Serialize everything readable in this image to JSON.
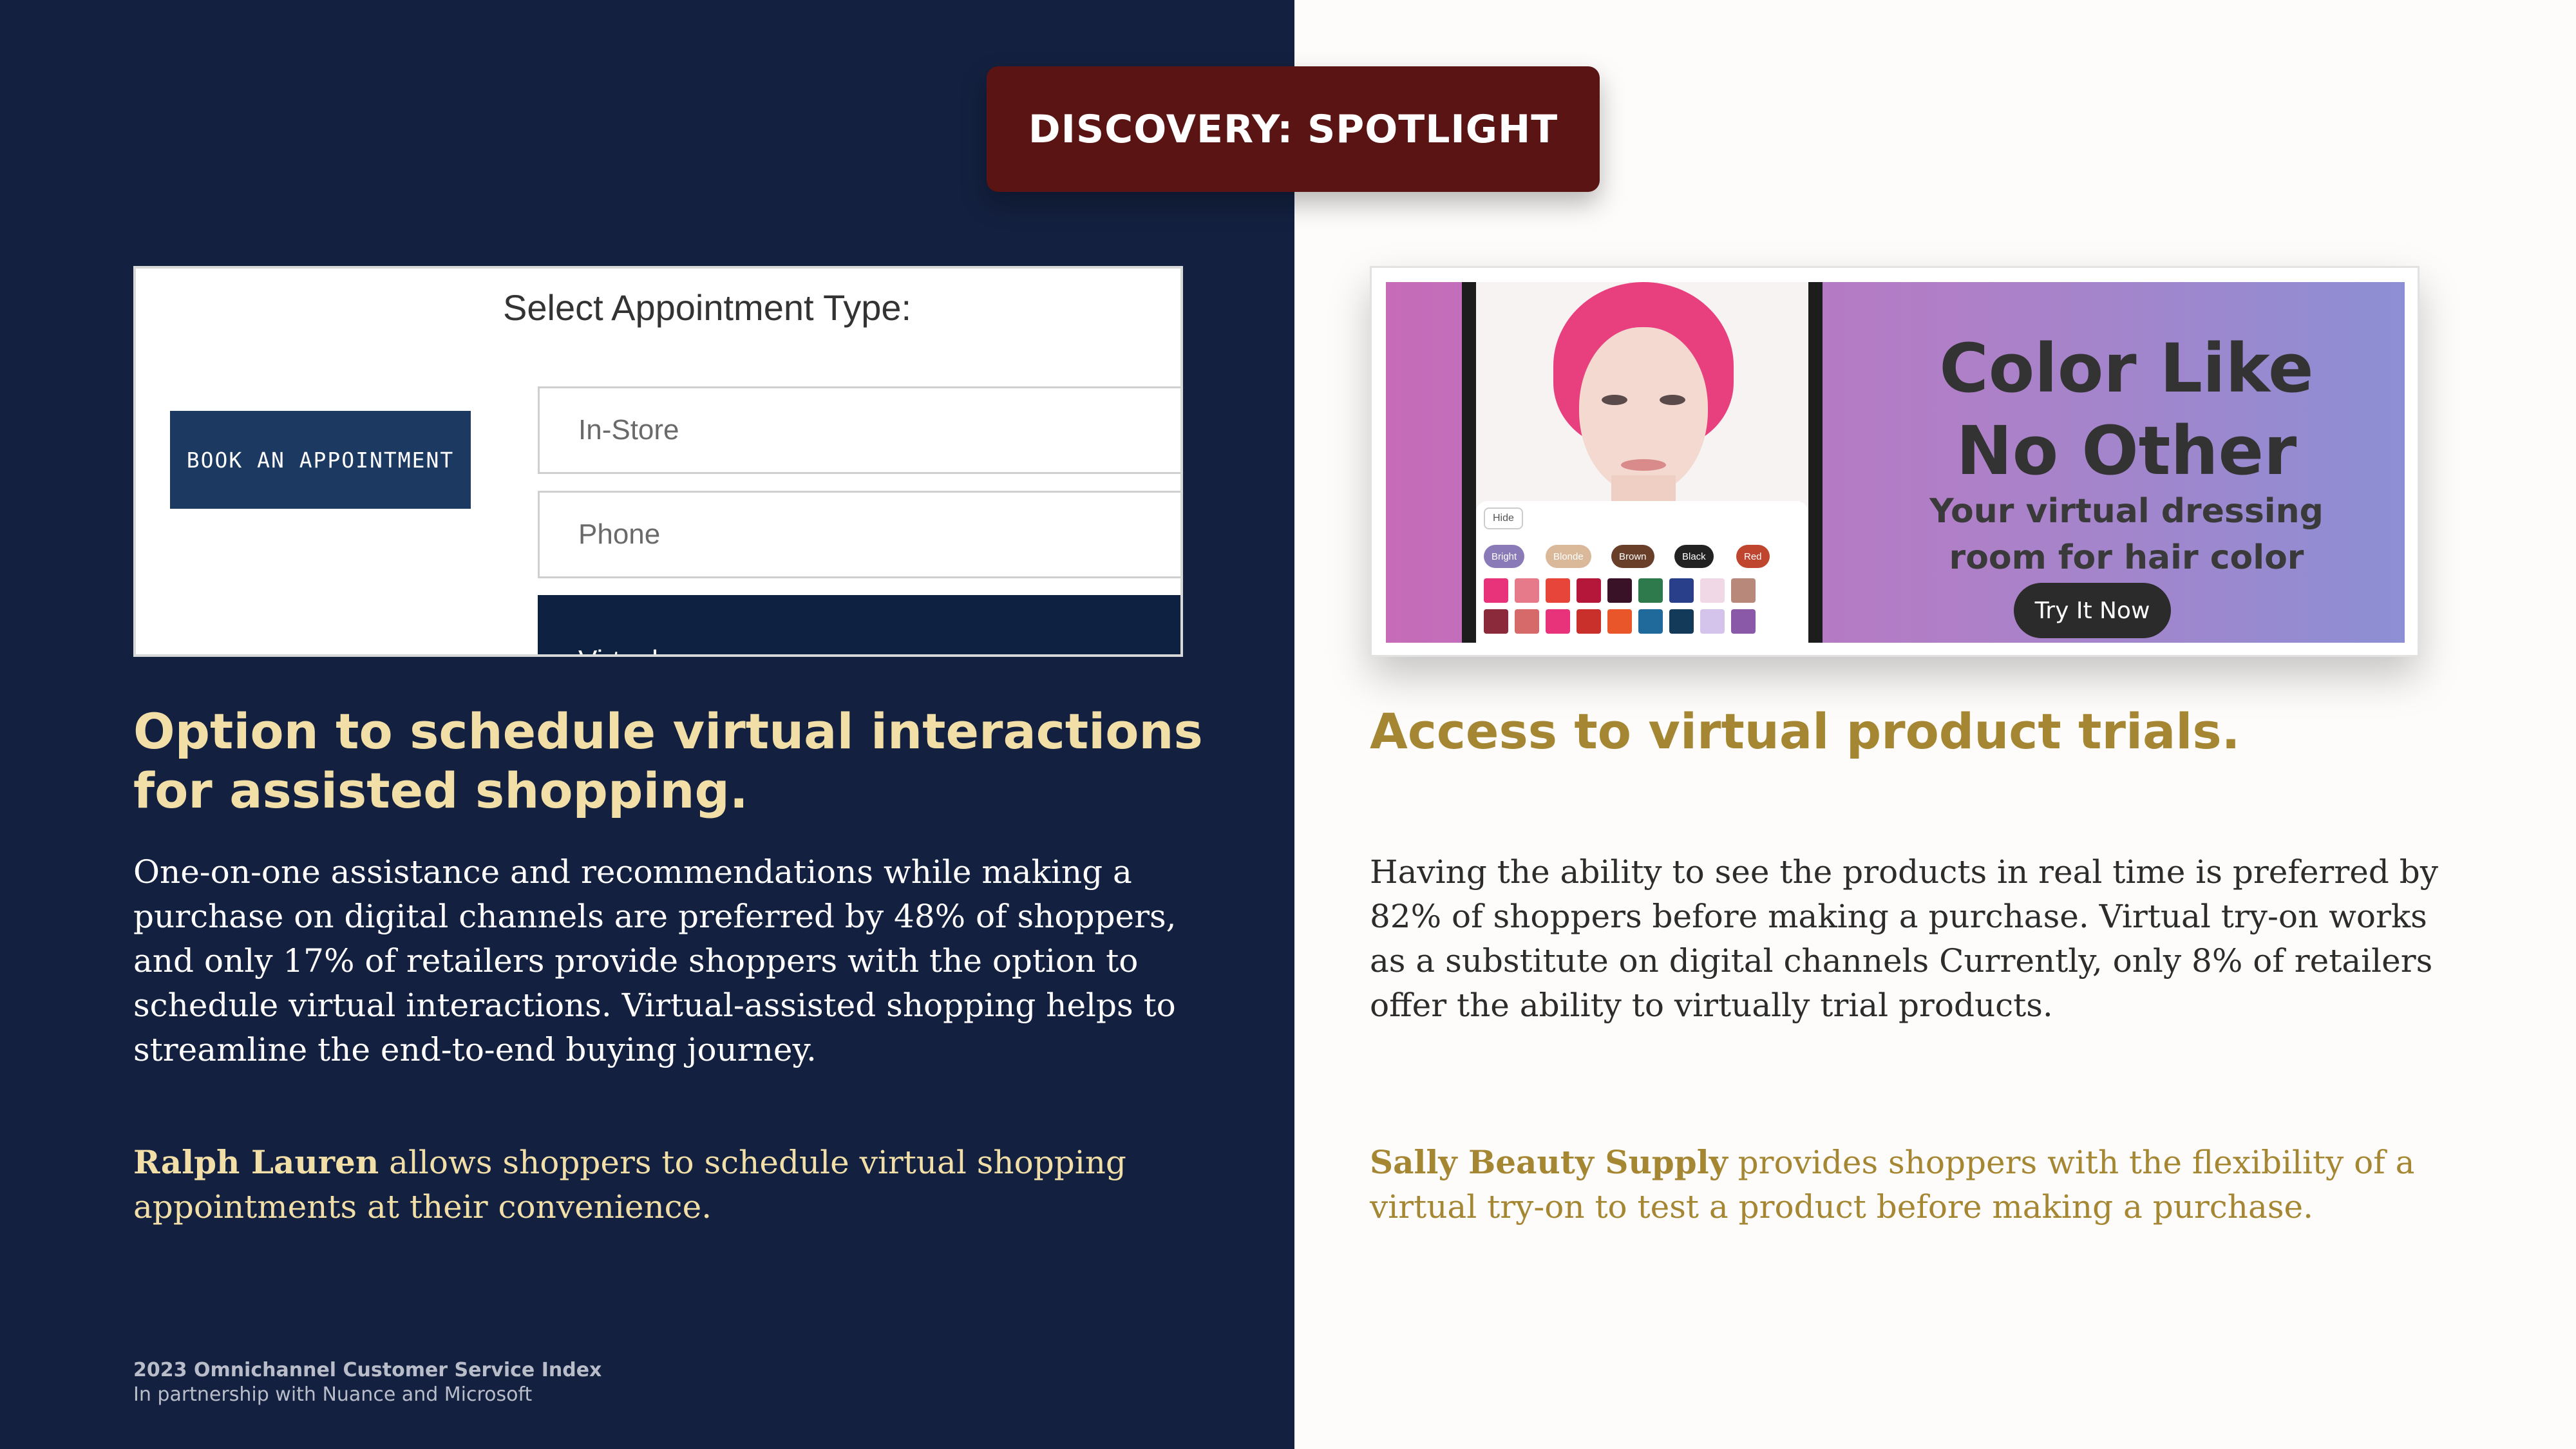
{
  "banner": {
    "label": "DISCOVERY: SPOTLIGHT"
  },
  "left": {
    "screenshot": {
      "title": "Select Appointment Type:",
      "book_button": "BOOK AN APPOINTMENT",
      "options": [
        "In-Store",
        "Phone",
        "Virtual"
      ],
      "selected_option": "Virtual"
    },
    "headline": "Option to schedule virtual interactions for assisted shopping.",
    "body": "One-on-one assistance and recommendations while making a purchase on digital channels are preferred by 48% of shoppers, and only 17% of retailers provide shoppers with the option to schedule virtual interactions. Virtual-assisted shopping helps to streamline the end-to-end buying journey.",
    "example_brand": "Ralph Lauren",
    "example_text": " allows shoppers to schedule virtual shopping appointments at their convenience."
  },
  "right": {
    "screenshot": {
      "hide_label": "Hide",
      "color_chips": [
        "Bright",
        "Blonde",
        "Brown",
        "Black",
        "Red"
      ],
      "promo_title_line1": "Color Like",
      "promo_title_line2": "No Other",
      "promo_sub_line1": "Your virtual dressing",
      "promo_sub_line2": "room for hair color",
      "try_button": "Try It Now"
    },
    "headline": "Access to virtual product trials.",
    "body": "Having the ability to see the products in real time is preferred by 82% of shoppers before making a purchase. Virtual try-on works as a substitute on digital channels  Currently, only 8% of retailers offer the ability to virtually trial products.",
    "example_brand": "Sally Beauty Supply",
    "example_text": " provides shoppers with the flexibility of a virtual try-on to test a product before making a purchase."
  },
  "footer": {
    "title": "2023 Omnichannel Customer Service Index",
    "subtitle": "In partnership with Nuance and Microsoft"
  },
  "colors": {
    "left_bg": "#13203f",
    "banner_bg": "#5a1414",
    "left_accent": "#f2dfa8",
    "right_accent": "#a58632"
  }
}
